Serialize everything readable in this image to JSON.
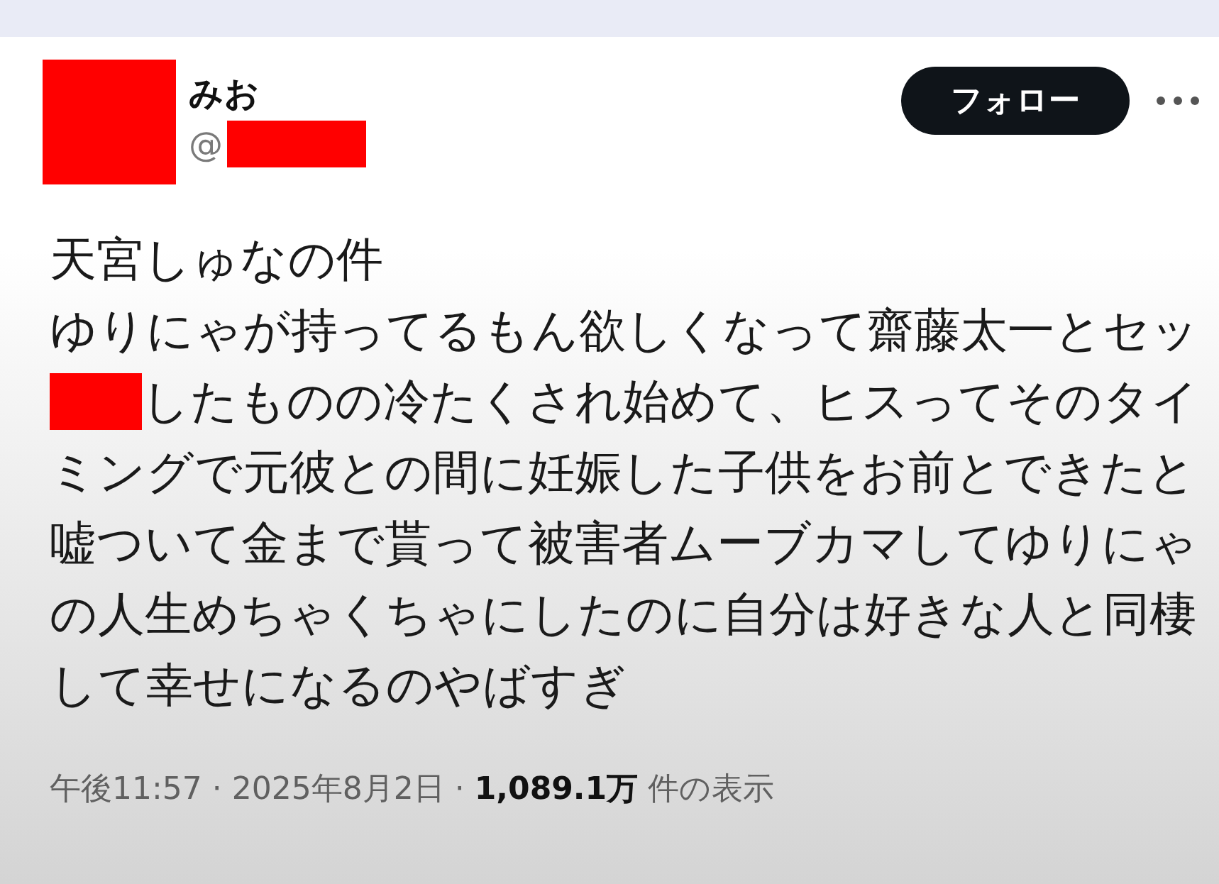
{
  "header": {
    "avatar": {
      "redacted": true
    },
    "display_name": "みお",
    "handle": {
      "prefix": "@",
      "redacted": true
    },
    "follow_button": "フォロー"
  },
  "body": {
    "lines": [
      {
        "redacted_prefix": false,
        "text": "天宮しゅなの件"
      },
      {
        "redacted_prefix": false,
        "text": "ゆりにゃが持ってるもん欲しくなって齋藤太一とセッ"
      },
      {
        "redacted_prefix": true,
        "text": "したものの冷たくされ始めて、ヒスってそのタイ"
      },
      {
        "redacted_prefix": false,
        "text": "ミングで元彼との間に妊娠した子供をお前とできたと"
      },
      {
        "redacted_prefix": false,
        "text": "嘘ついて金まで貰って被害者ムーブカマしてゆりにゃ"
      },
      {
        "redacted_prefix": false,
        "text": "の人生めちゃくちゃにしたのに自分は好きな人と同棲"
      },
      {
        "redacted_prefix": false,
        "text": "して幸せになるのやばすぎ"
      }
    ]
  },
  "meta": "午後11:57 · 2025年8月2日 · **1,089.1万** 件の表示"
}
